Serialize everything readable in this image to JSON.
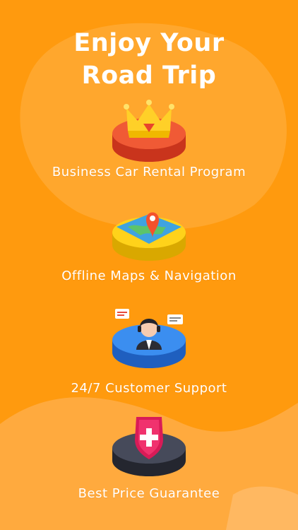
{
  "title": {
    "line1": "Enjoy Your",
    "line2": "Road Trip"
  },
  "colors": {
    "background": "#ff9a0e",
    "background_light": "#ffb347",
    "text": "#ffffff"
  },
  "features": [
    {
      "label": "Business Car Rental Program",
      "icon": "crown-icon",
      "color": "#e8452c"
    },
    {
      "label": "Offline Maps & Navigation",
      "icon": "map-pin-icon",
      "color": "#f5c518"
    },
    {
      "label": "24/7 Customer Support",
      "icon": "support-agent-icon",
      "color": "#2e7be0"
    },
    {
      "label": "Best Price Guarantee",
      "icon": "shield-plus-icon",
      "color": "#3a3d4c"
    }
  ]
}
